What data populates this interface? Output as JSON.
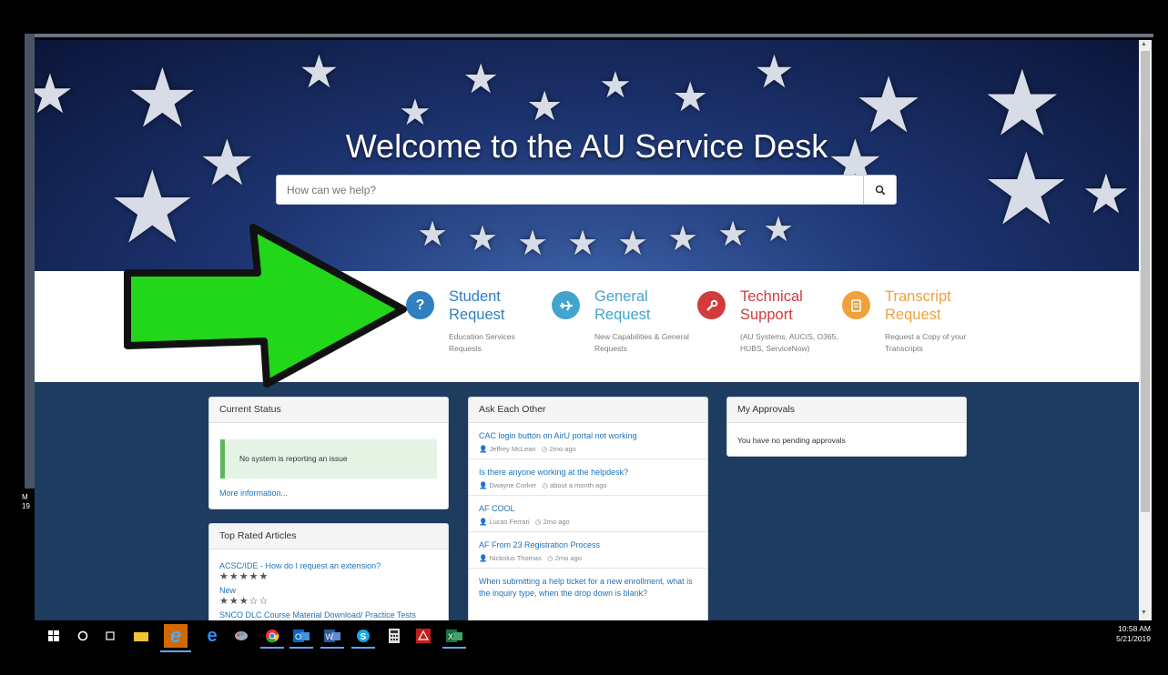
{
  "hero": {
    "title": "Welcome to the AU Service Desk",
    "search_placeholder": "How can we help?",
    "search_icon": "search-icon"
  },
  "categories": [
    {
      "title_line1": "Student",
      "title_line2": "Request",
      "desc": "Education Services Requests",
      "icon": "question-icon",
      "color": "#2f7fc1",
      "text_color": "#2f7fc1"
    },
    {
      "title_line1": "General",
      "title_line2": "Request",
      "desc": "New Capabilities & General Requests",
      "icon": "airplane-icon",
      "color": "#42a4cf",
      "text_color": "#42a4cf"
    },
    {
      "title_line1": "Technical",
      "title_line2": "Support",
      "desc": "(AU Systems, AUCIS, O365, HUBS, ServiceNow)",
      "icon": "wrench-icon",
      "color": "#d13b3b",
      "text_color": "#d13b3b"
    },
    {
      "title_line1": "Transcript",
      "title_line2": "Request",
      "desc": "Request a Copy of your Transcripts",
      "icon": "document-icon",
      "color": "#f0a13c",
      "text_color": "#f0a13c"
    }
  ],
  "current_status": {
    "title": "Current Status",
    "message": "No system is reporting an issue",
    "more_link": "More information..."
  },
  "top_rated": {
    "title": "Top Rated Articles",
    "articles": [
      {
        "title": "ACSC/IDE - How do I request an extension?",
        "stars": "★★★★★"
      },
      {
        "title": "New",
        "stars": "★★★☆☆"
      },
      {
        "title": "SNCO DLC Course Material Download/ Practice Tests",
        "stars": ""
      }
    ]
  },
  "ask_each_other": {
    "title": "Ask Each Other",
    "items": [
      {
        "question": "CAC login button on AirU portal not working",
        "author": "Jeffrey McLean",
        "time": "2mo ago"
      },
      {
        "question": "Is there anyone working at the helpdesk?",
        "author": "Dwayne Corker",
        "time": "about a month ago"
      },
      {
        "question": "AF COOL",
        "author": "Lucas Ferrari",
        "time": "2mo ago"
      },
      {
        "question": "AF From 23 Registration Process",
        "author": "Nickolus Thomas",
        "time": "2mo ago"
      },
      {
        "question": "When submitting a help ticket for a new enrollment, what is the inquiry type, when the drop down is blank?",
        "author": "",
        "time": ""
      }
    ]
  },
  "approvals": {
    "title": "My Approvals",
    "message": "You have no pending approvals"
  },
  "taskbar": {
    "time": "10:58 AM",
    "date": "5/21/2019",
    "icons": [
      "windows-start-icon",
      "cortana-search-icon",
      "task-view-icon",
      "file-explorer-icon",
      "internet-explorer-icon",
      "edge-icon",
      "paint-icon",
      "chrome-icon",
      "outlook-icon",
      "word-icon",
      "skype-icon",
      "calculator-icon",
      "acrobat-icon",
      "excel-icon"
    ]
  },
  "side_label": {
    "line1": "M",
    "line2": "19"
  }
}
